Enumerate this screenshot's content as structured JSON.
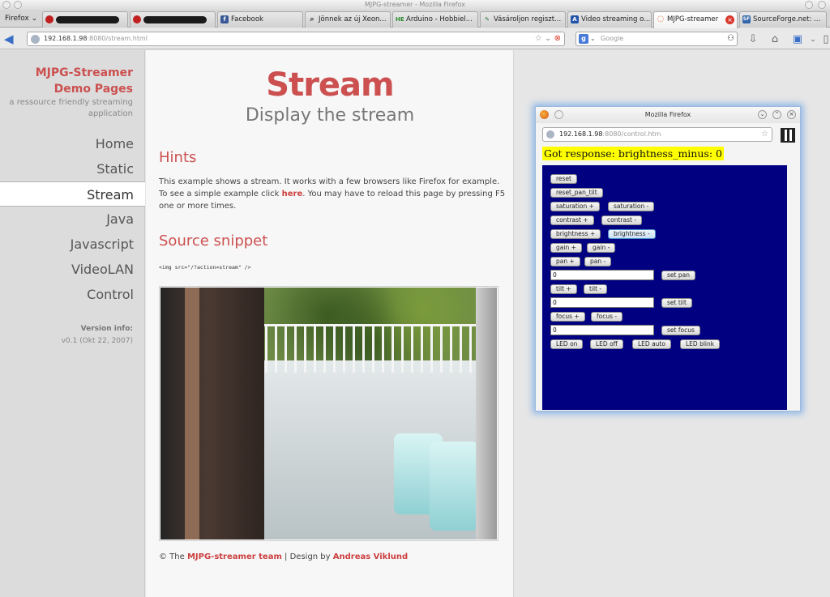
{
  "window": {
    "title": "MJPG-streamer - Mozilla Firefox"
  },
  "tabbar": {
    "menu_label": "Firefox",
    "tabs": [
      {
        "label": "",
        "icon": "redacted-icon"
      },
      {
        "label": "",
        "icon": "redacted-icon"
      },
      {
        "label": "Facebook",
        "icon": "facebook-icon",
        "fav": "f",
        "color": "#3b5998"
      },
      {
        "label": "Jönnek az új Xeon...",
        "icon": "search-icon",
        "fav": "⌕",
        "color": "#555555"
      },
      {
        "label": "Arduino - Hobbiel...",
        "icon": "he-icon",
        "fav": "HE",
        "color": "#2a8a2a"
      },
      {
        "label": "Vásároljon regiszt...",
        "icon": "wrench-icon",
        "fav": "✎",
        "color": "#2a7a3a"
      },
      {
        "label": "Video streaming o...",
        "icon": "ax-icon",
        "fav": "A",
        "color": "#2255aa"
      },
      {
        "label": "MJPG-streamer",
        "icon": "loading-icon",
        "fav": "◌",
        "color": "#d86020",
        "active": true
      },
      {
        "label": "SourceForge.net: ...",
        "icon": "sf-icon",
        "fav": "SF",
        "color": "#3366aa"
      }
    ]
  },
  "navbar": {
    "url_host": "192.168.1.98",
    "url_rest": ":8080/stream.html",
    "search_placeholder": "Google"
  },
  "sidebar": {
    "brand_line1": "MJPG-Streamer",
    "brand_line2": "Demo Pages",
    "tagline": "a ressource friendly streaming application",
    "items": [
      "Home",
      "Static",
      "Stream",
      "Java",
      "Javascript",
      "VideoLAN",
      "Control"
    ],
    "active": "Stream",
    "version_label": "Version info:",
    "version_value": "v0.1 (Okt 22, 2007)"
  },
  "content": {
    "title": "Stream",
    "subtitle": "Display the stream",
    "hints_heading": "Hints",
    "hints_text_1": "This example shows a stream. It works with a few browsers like Firefox for example. To see a simple example click ",
    "hints_link": "here",
    "hints_text_2": ". You may have to reload this page by pressing F5 one or more times.",
    "snippet_heading": "Source snippet",
    "snippet_code": "<img src=\"/?action=stream\" />",
    "footer_prefix": "© The ",
    "footer_team": "MJPG-streamer team",
    "footer_mid": " | Design by ",
    "footer_author": "Andreas Viklund"
  },
  "popup": {
    "title": "Mozilla Firefox",
    "url_host": "192.168.1.98",
    "url_rest": ":8080/control.htm",
    "response": "Got response: brightness_minus: 0",
    "buttons": {
      "reset": "reset",
      "reset_pan_tilt": "reset_pan_tilt",
      "saturation_plus": "saturation +",
      "saturation_minus": "saturation -",
      "contrast_plus": "contrast +",
      "contrast_minus": "contrast -",
      "brightness_plus": "brightness +",
      "brightness_minus": "brightness -",
      "gain_plus": "gain +",
      "gain_minus": "gain -",
      "pan_plus": "pan +",
      "pan_minus": "pan -",
      "set_pan": "set pan",
      "tilt_plus": "tilt +",
      "tilt_minus": "tilt -",
      "set_tilt": "set tilt",
      "focus_plus": "focus +",
      "focus_minus": "focus -",
      "set_focus": "set focus",
      "led_on": "LED on",
      "led_off": "LED off",
      "led_auto": "LED auto",
      "led_blink": "LED blink"
    },
    "pan_value": "0",
    "tilt_value": "0",
    "focus_value": "0"
  }
}
